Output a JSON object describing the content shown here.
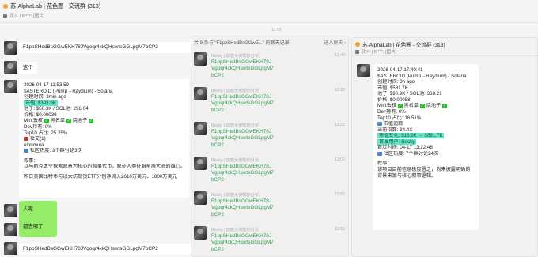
{
  "header": {
    "title": "苏-AlphaLab | 花色圈 - 交流群 (313)",
    "subtitle": "北斗 | 8 ***: [图片]"
  },
  "center_time": "11:53",
  "left_messages": {
    "msg1": "F1ppSHedBsGGwEKH78JVgoqr4xkQHswtsGGLpgM7bCP2",
    "msg2": "这个",
    "msg3": "人呢",
    "msg4": "都去哪了",
    "msg5": "F1ppSHedBsGGwEKH78JVgoqr4xkQHswtsGGLpgM7bCP2"
  },
  "card": {
    "time": "2026-04-17 11:53:59",
    "token": "$ASTEROID (Pump→Raydium) - Solana",
    "created": "创建时间: 3min ago",
    "mcap": "市值: $393.9K",
    "pool": "池子: $50.3K / SOL池: 298.04",
    "price": "价格: $0.00039",
    "mint": "Mint丢权",
    "burn": "黑名单",
    "burnpool": "烧池子",
    "dev": "Dev持有: 0%",
    "top10": "Top10 占比: 25.25%",
    "kol": "社交(1)",
    "kol_name": "elonmusk",
    "community": "社区热度: 3个群讨论3次",
    "narrative_head": "叙事：",
    "narrative": "以马斯克太空探索愿景为核心的叙事代币，象征人类征服星辰大海的雄心。",
    "news": "昨日美国比特币与以太坊现货ETF分别净流入2610万美元、1800万美元"
  },
  "forward": {
    "header": "共 9 条与 \"F1ppSHedBsGGwE...\" 的聊天记录",
    "enter": "进入聊天 ›",
    "items": [
      {
        "name": "Rocky | 加密大佬帮你分析",
        "time": "12:40",
        "text": "F1ppSHedBsGGwEKH78JVgoqr4xkQHswtsGGLpgM7bCP2"
      },
      {
        "name": "Rocky | 加密大佬帮你分析",
        "time": "12:22",
        "text": "F1ppSHedBsGGwEKH78JVgoqr4xkQHswtsGGLpgM7bCP2"
      },
      {
        "name": "Rocky | 加密大佬帮你分析",
        "time": "12:22",
        "text": "F1ppSHedBsGGwEKH78JVgoqr4xkQHswtsGGLpgM7bCP2"
      },
      {
        "name": "Rocky | 加密大佬帮你分析",
        "time": "12:02",
        "text": "F1ppSHedBsGGwEKH78JVgoqr4xkQHswtsGGLpgM7bCP2"
      },
      {
        "name": "Rocky | 加密大佬帮你分析",
        "time": "11:55",
        "text": "F1ppSHedBsGGwEKH78JVgoqr4xkQHswtsGGLpgM7bCP2"
      },
      {
        "name": "Rocky | 加密大佬帮你分析",
        "time": "11:53",
        "text": "F1ppSHedBsGGwEKH78JVgoqr4xkQHswtsGGLpgM7bCP2"
      }
    ]
  },
  "panel": {
    "title": "苏-AlphaLab | 花色圈 - 交流群 (313)",
    "subtitle": "北斗 | 8 ***: [图片]",
    "time": "2026-04-17 17:40:41",
    "token": "$ASTEROID (Pump→Raydium) - Solana",
    "created": "创建时间: 3h ago",
    "mcap": "市值: $581.7K",
    "pool": "池子: $90.9K / SOL池: 368.21",
    "price": "价格: $0.00058",
    "mint": "Mint丢权",
    "burn": "黑名单",
    "burnpool": "烧池子",
    "dev": "Dev持有: 0%",
    "top10": "Top10 占比: 16.51%",
    "market": "市值追踪",
    "multiplier": "当前倍数: 34.4X",
    "mcap_change": "市值变化: $16.9K → $581.7K",
    "first_caller": "首发用户: Rocky",
    "first_time": "首次时间: 04-17 13:22:46",
    "community": "社区热度: 7个群讨论24次",
    "narrative_head": "叙事：",
    "narrative": "该项目目前信息极度匮乏，尚未披露明确的背景来源与核心叙事逻辑。"
  }
}
